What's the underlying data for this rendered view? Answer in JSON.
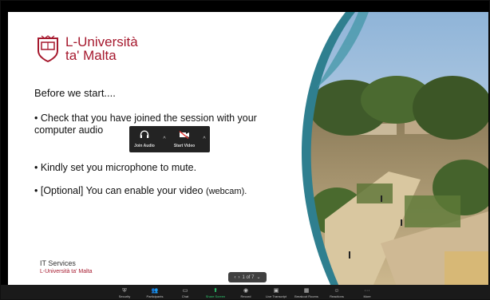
{
  "logo": {
    "line1": "L-Università",
    "line2": "ta' Malta"
  },
  "slide": {
    "heading": "Before we start....",
    "bullet1": "• Check that you have joined the session with your computer audio",
    "bullet2": "• Kindly set you microphone to mute.",
    "bullet3_main": "• [Optional] You can enable your video ",
    "bullet3_small": "(webcam).",
    "footer_line1": "IT Services",
    "footer_line2": "L-Università ta' Malta"
  },
  "popup": {
    "join_audio": "Join Audio",
    "start_video": "Start Video"
  },
  "pager": {
    "text": "1 of 7"
  },
  "toolbar": {
    "items": [
      {
        "label": "Security",
        "icon": "shield-icon"
      },
      {
        "label": "Participants",
        "icon": "participants-icon"
      },
      {
        "label": "Chat",
        "icon": "chat-icon"
      },
      {
        "label": "Share Screen",
        "icon": "share-screen-icon"
      },
      {
        "label": "Record",
        "icon": "record-icon"
      },
      {
        "label": "Live Transcript",
        "icon": "cc-icon"
      },
      {
        "label": "Breakout Rooms",
        "icon": "breakout-icon"
      },
      {
        "label": "Reactions",
        "icon": "reactions-icon"
      },
      {
        "label": "More",
        "icon": "more-icon"
      }
    ]
  },
  "colors": {
    "brand": "#a6192e",
    "teal_band": "#2f7f8f",
    "toolbar_bg": "#1a1a1a",
    "share_green": "#2ecc71"
  }
}
